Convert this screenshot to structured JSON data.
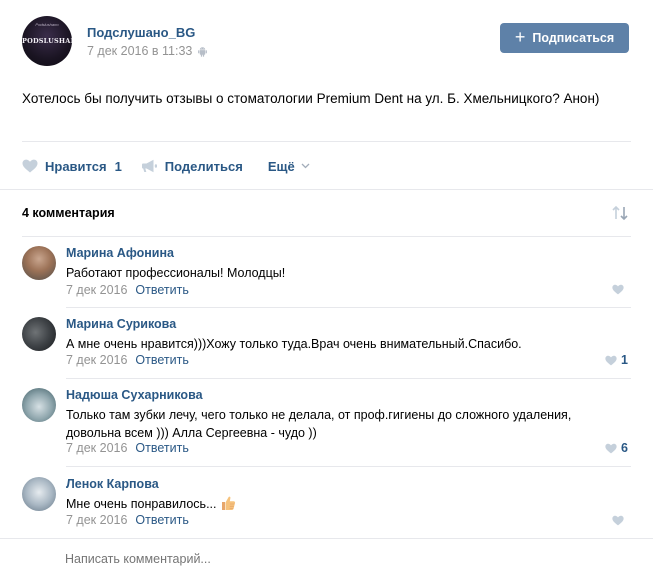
{
  "post": {
    "community_name": "Подслушано_BG",
    "community_logo_text": "PODSLUSHANO",
    "community_logo_small": "Podslushano",
    "date": "7 дек 2016 в 11:33",
    "subscribe_label": "Подписаться",
    "text": "Хотелось бы получить отзывы о стоматологии Premium Dent на ул. Б. Хмельницкого? Анон)",
    "like_label": "Нравится",
    "like_count": "1",
    "share_label": "Поделиться",
    "more_label": "Ещё"
  },
  "comments_header": "4 комментария",
  "comments": [
    {
      "author": "Марина Афонина",
      "text": "Работают профессионалы! Молодцы!",
      "date": "7 дек 2016",
      "reply_label": "Ответить",
      "likes": ""
    },
    {
      "author": "Марина Сурикова",
      "text": "А мне очень нравится)))Хожу только туда.Врач очень внимательный.Спасибо.",
      "date": "7 дек 2016",
      "reply_label": "Ответить",
      "likes": "1"
    },
    {
      "author": "Надюша Сухарникова",
      "text": "Только там зубки лечу, чего только не делала, от проф.гигиены до сложного удаления, довольна всем ))) Алла Сергеевна - чудо ))",
      "date": "7 дек 2016",
      "reply_label": "Ответить",
      "likes": "6"
    },
    {
      "author": "Ленок Карпова",
      "text": "Мне очень понравилось...",
      "date": "7 дек 2016",
      "reply_label": "Ответить",
      "likes": ""
    }
  ],
  "comment_input": {
    "placeholder": "Написать комментарий..."
  },
  "colors": {
    "link": "#2a5885",
    "button": "#5e81a8",
    "meta": "#939393",
    "divider": "#e7e8ec"
  },
  "icons": [
    "android-icon",
    "plus-icon",
    "heart-icon",
    "megaphone-icon",
    "chevron-down-icon",
    "sort-icon",
    "thumbs-up-emoji"
  ]
}
